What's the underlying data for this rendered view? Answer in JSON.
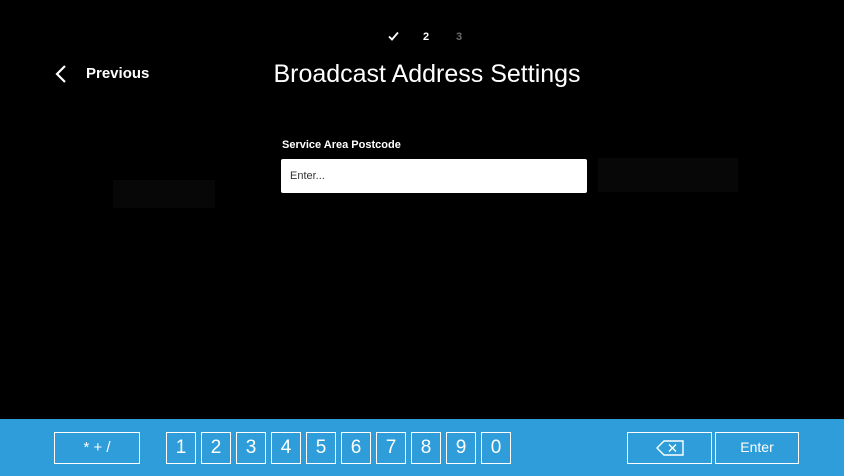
{
  "steps": [
    {
      "label": "✓",
      "state": "done",
      "icon": "checkmark-icon"
    },
    {
      "label": "2",
      "state": "current"
    },
    {
      "label": "3",
      "state": "upcoming"
    }
  ],
  "header": {
    "back_label": "Previous",
    "back_icon": "chevron-left-icon",
    "title": "Broadcast Address Settings"
  },
  "form": {
    "field_label": "Service Area Postcode",
    "placeholder": "Enter...",
    "value": ""
  },
  "keyboard": {
    "background_color": "#2e9dd9",
    "symbols_label": "* + /",
    "digits": [
      "1",
      "2",
      "3",
      "4",
      "5",
      "6",
      "7",
      "8",
      "9",
      "0"
    ],
    "backspace_icon": "backspace-icon",
    "enter_label": "Enter"
  }
}
